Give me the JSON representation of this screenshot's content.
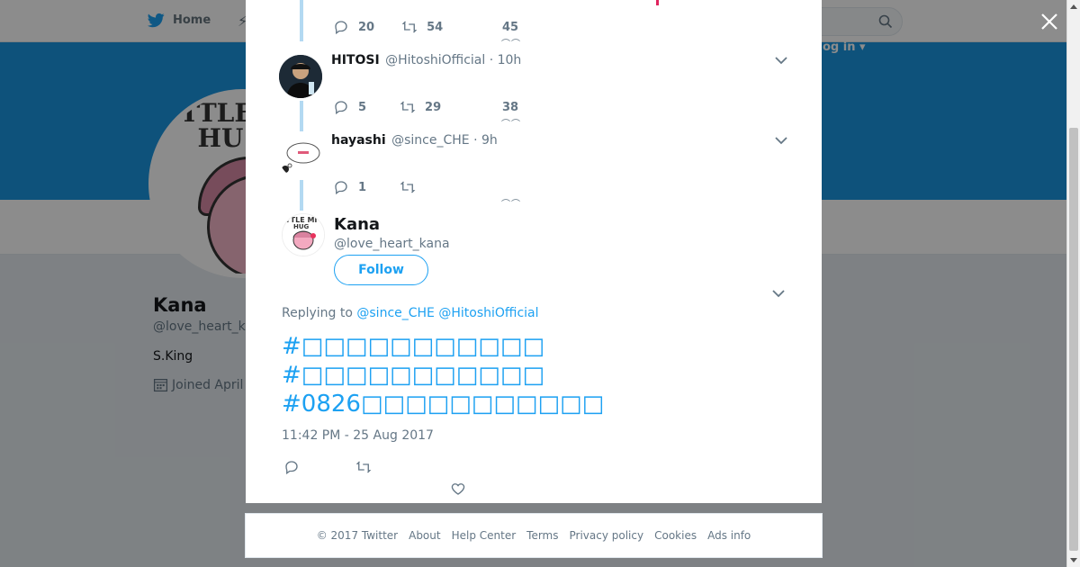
{
  "topbar": {
    "home_label": "Home",
    "login_label": "og in ▾"
  },
  "profile": {
    "name": "Kana",
    "handle": "@love_heart_k",
    "bio": "S.King",
    "joined": "Joined April",
    "avatar_text": "TTLE\nHU"
  },
  "thread": {
    "top_actions": {
      "replies": "20",
      "retweets": "54",
      "likes": "45"
    },
    "tweets": [
      {
        "name": "HITOSI",
        "handle": "@HitoshiOfficial",
        "time": "· 10h",
        "replies": "5",
        "retweets": "29",
        "likes": "38"
      },
      {
        "name": "hayashi",
        "handle": "@since_CHE",
        "time": "· 9h",
        "replies": "1",
        "retweets": ""
      }
    ]
  },
  "main_tweet": {
    "name": "Kana",
    "handle": "@love_heart_kana",
    "follow_label": "Follow",
    "replying_prefix": "Replying to",
    "reply_to_1": "@since_CHE",
    "reply_to_2": "@HitoshiOfficial",
    "hashtags": [
      "#□□□□□□□□□□□",
      "#□□□□□□□□□□□",
      "#0826□□□□□□□□□□□"
    ],
    "timestamp": "11:42 PM - 25 Aug 2017"
  },
  "footer": {
    "links": [
      "© 2017 Twitter",
      "About",
      "Help Center",
      "Terms",
      "Privacy policy",
      "Cookies",
      "Ads info"
    ]
  },
  "colors": {
    "accent": "#1da1f2",
    "cover": "#1b95e0",
    "thread_line": "#b3d9f2"
  },
  "icons": [
    "twitter-bird-icon",
    "search-icon",
    "close-icon",
    "reply-icon",
    "retweet-icon",
    "like-icon",
    "chevron-down-icon",
    "calendar-icon"
  ]
}
